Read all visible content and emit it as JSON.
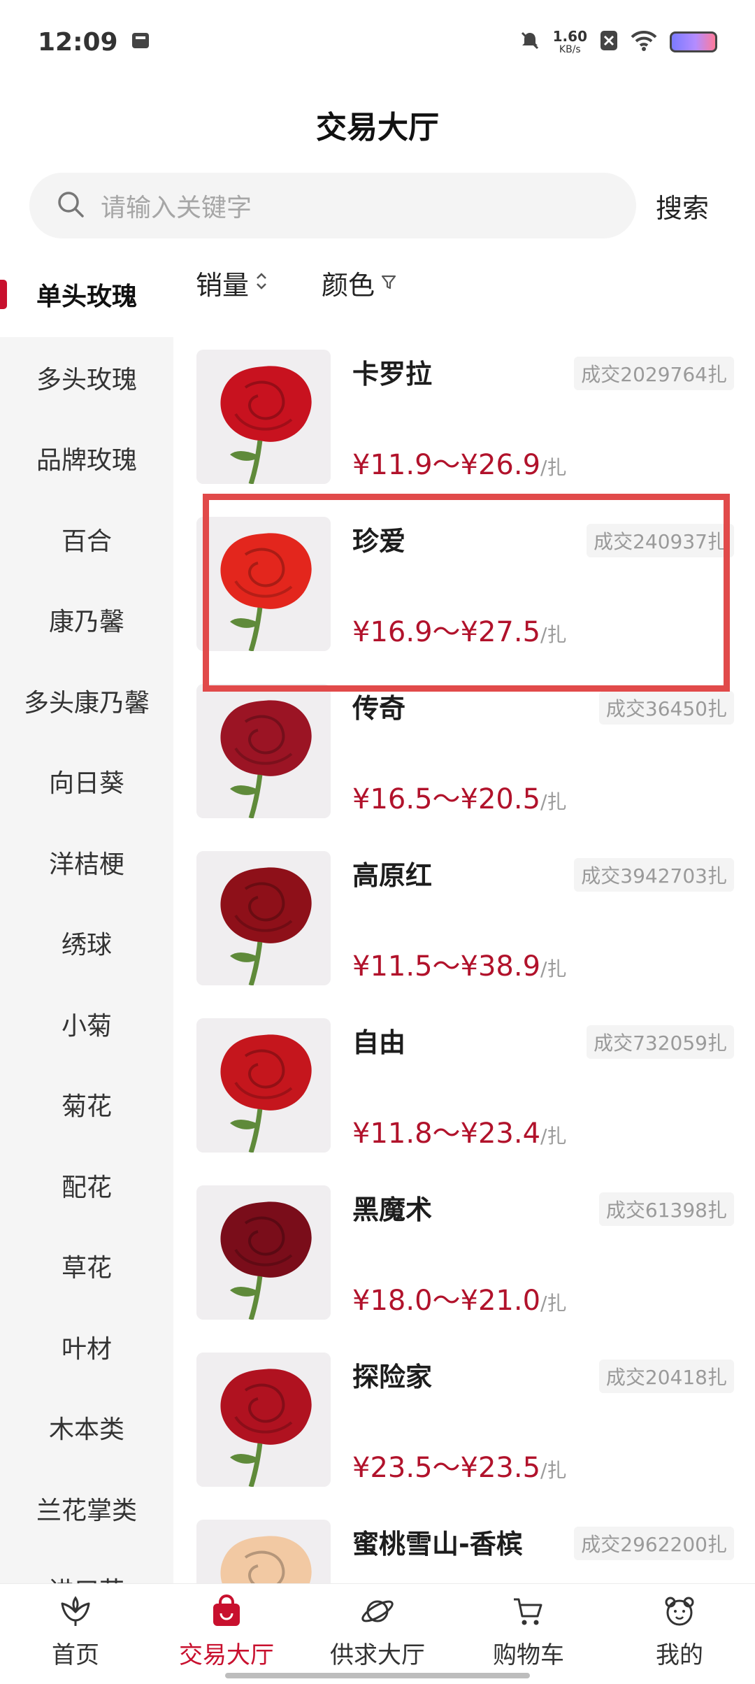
{
  "status_bar": {
    "time": "12:09",
    "net_speed_value": "1.60",
    "net_speed_unit": "KB/s"
  },
  "header": {
    "title": "交易大厅"
  },
  "search": {
    "placeholder": "请输入关键字",
    "button_label": "搜索"
  },
  "sidebar": {
    "items": [
      {
        "label": "单头玫瑰"
      },
      {
        "label": "多头玫瑰"
      },
      {
        "label": "品牌玫瑰"
      },
      {
        "label": "百合"
      },
      {
        "label": "康乃馨"
      },
      {
        "label": "多头康乃馨"
      },
      {
        "label": "向日葵"
      },
      {
        "label": "洋桔梗"
      },
      {
        "label": "绣球"
      },
      {
        "label": "小菊"
      },
      {
        "label": "菊花"
      },
      {
        "label": "配花"
      },
      {
        "label": "草花"
      },
      {
        "label": "叶材"
      },
      {
        "label": "木本类"
      },
      {
        "label": "兰花掌类"
      },
      {
        "label": "进口花"
      }
    ],
    "active_index": 0
  },
  "filters": {
    "sales_label": "销量",
    "color_label": "颜色"
  },
  "products": [
    {
      "name": "卡罗拉",
      "deal": "成交2029764扎",
      "price": "¥11.9～¥26.9",
      "unit": "/扎",
      "color": "#c8121f"
    },
    {
      "name": "珍爱",
      "deal": "成交240937扎",
      "price": "¥16.9～¥27.5",
      "unit": "/扎",
      "color": "#e3261d"
    },
    {
      "name": "传奇",
      "deal": "成交36450扎",
      "price": "¥16.5～¥20.5",
      "unit": "/扎",
      "color": "#9b1424"
    },
    {
      "name": "高原红",
      "deal": "成交3942703扎",
      "price": "¥11.5～¥38.9",
      "unit": "/扎",
      "color": "#8e1019"
    },
    {
      "name": "自由",
      "deal": "成交732059扎",
      "price": "¥11.8～¥23.4",
      "unit": "/扎",
      "color": "#c5161d"
    },
    {
      "name": "黑魔术",
      "deal": "成交61398扎",
      "price": "¥18.0～¥21.0",
      "unit": "/扎",
      "color": "#7a0d1a"
    },
    {
      "name": "探险家",
      "deal": "成交20418扎",
      "price": "¥23.5～¥23.5",
      "unit": "/扎",
      "color": "#b01220"
    },
    {
      "name": "蜜桃雪山-香槟",
      "deal": "成交2962200扎",
      "price": "",
      "unit": "",
      "color": "#f2c9a3"
    }
  ],
  "bottom_nav": {
    "items": [
      {
        "label": "首页"
      },
      {
        "label": "交易大厅"
      },
      {
        "label": "供求大厅"
      },
      {
        "label": "购物车"
      },
      {
        "label": "我的"
      }
    ],
    "active_index": 1
  },
  "colors": {
    "accent": "#c8102e",
    "price": "#b1122b",
    "highlight_border": "#e14a4a"
  }
}
